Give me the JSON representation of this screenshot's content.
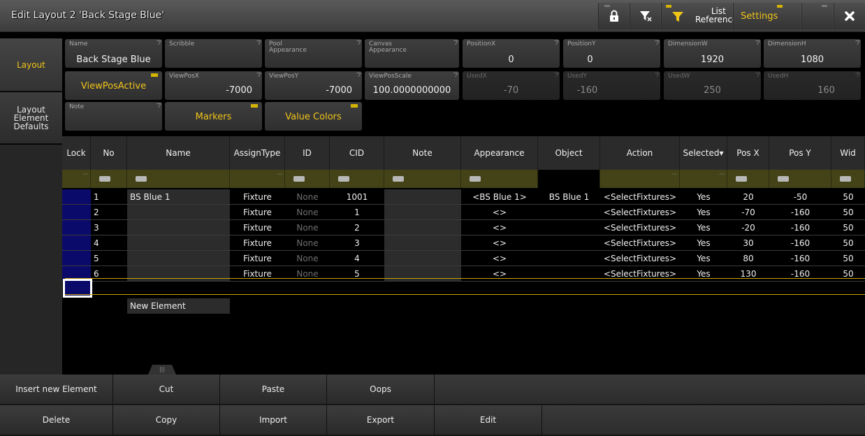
{
  "window": {
    "title": "Edit Layout 2 'Back Stage Blue'",
    "buttons": {
      "list_references": "List\nReferences",
      "settings": "Settings"
    }
  },
  "left_tabs": [
    {
      "label": "Layout",
      "active": true
    },
    {
      "label": "Layout\nElement\nDefaults",
      "active": false
    }
  ],
  "properties": {
    "name": {
      "label": "Name",
      "value": "Back Stage Blue"
    },
    "scribble": {
      "label": "Scribble",
      "value": ""
    },
    "pool_appearance": {
      "label": "Pool\nAppearance",
      "value": ""
    },
    "canvas_appearance": {
      "label": "Canvas\nAppearance",
      "value": ""
    },
    "position_x": {
      "label": "PositionX",
      "value": "0"
    },
    "position_y": {
      "label": "PositionY",
      "value": "0"
    },
    "dimension_w": {
      "label": "DimensionW",
      "value": "1920"
    },
    "dimension_h": {
      "label": "DimensionH",
      "value": "1080"
    },
    "viewpos_active": {
      "label": "ViewPosActive"
    },
    "viewpos_x": {
      "label": "ViewPosX",
      "value": "-7000"
    },
    "viewpos_y": {
      "label": "ViewPosY",
      "value": "-7000"
    },
    "viewpos_scale": {
      "label": "ViewPosScale",
      "value": "100.0000000000"
    },
    "used_x": {
      "label": "UsedX",
      "value": "-70"
    },
    "used_y": {
      "label": "UsedY",
      "value": "-160"
    },
    "used_w": {
      "label": "UsedW",
      "value": "250"
    },
    "used_h": {
      "label": "UsedH",
      "value": "160"
    },
    "note": {
      "label": "Note",
      "value": ""
    },
    "markers": {
      "label": "Markers"
    },
    "value_colors": {
      "label": "Value Colors"
    }
  },
  "table": {
    "columns": [
      "Lock",
      "No",
      "Name",
      "AssignType",
      "ID",
      "CID",
      "Note",
      "Appearance",
      "Object",
      "Action",
      "Selected▾",
      "Pos X",
      "Pos Y",
      "Wid"
    ],
    "rows": [
      {
        "no": "1",
        "name": "BS Blue 1",
        "assign": "Fixture",
        "id": "None",
        "cid": "1001",
        "note": "",
        "appearance": "<BS Blue 1>",
        "object": "BS Blue 1",
        "action": "<SelectFixtures>",
        "selected": "Yes",
        "posx": "20",
        "posy": "-50",
        "wid": "50"
      },
      {
        "no": "2",
        "name": "",
        "assign": "Fixture",
        "id": "None",
        "cid": "1",
        "note": "",
        "appearance": "<>",
        "object": "",
        "action": "<SelectFixtures>",
        "selected": "Yes",
        "posx": "-70",
        "posy": "-160",
        "wid": "50"
      },
      {
        "no": "3",
        "name": "",
        "assign": "Fixture",
        "id": "None",
        "cid": "2",
        "note": "",
        "appearance": "<>",
        "object": "",
        "action": "<SelectFixtures>",
        "selected": "Yes",
        "posx": "-20",
        "posy": "-160",
        "wid": "50"
      },
      {
        "no": "4",
        "name": "",
        "assign": "Fixture",
        "id": "None",
        "cid": "3",
        "note": "",
        "appearance": "<>",
        "object": "",
        "action": "<SelectFixtures>",
        "selected": "Yes",
        "posx": "30",
        "posy": "-160",
        "wid": "50"
      },
      {
        "no": "5",
        "name": "",
        "assign": "Fixture",
        "id": "None",
        "cid": "4",
        "note": "",
        "appearance": "<>",
        "object": "",
        "action": "<SelectFixtures>",
        "selected": "Yes",
        "posx": "80",
        "posy": "-160",
        "wid": "50"
      },
      {
        "no": "6",
        "name": "",
        "assign": "Fixture",
        "id": "None",
        "cid": "5",
        "note": "",
        "appearance": "<>",
        "object": "",
        "action": "<SelectFixtures>",
        "selected": "Yes",
        "posx": "130",
        "posy": "-160",
        "wid": "50"
      }
    ],
    "new_element": "New Element",
    "handle": "|||"
  },
  "bottom_buttons": {
    "row1": [
      "Insert new Element",
      "Cut",
      "Paste",
      "Oops"
    ],
    "row2": [
      "Delete",
      "Copy",
      "Import",
      "Export",
      "Edit"
    ]
  },
  "colors": {
    "accent": "#f0c419",
    "lock_blue": "#0a0a6b",
    "filter_row": "#444318"
  }
}
